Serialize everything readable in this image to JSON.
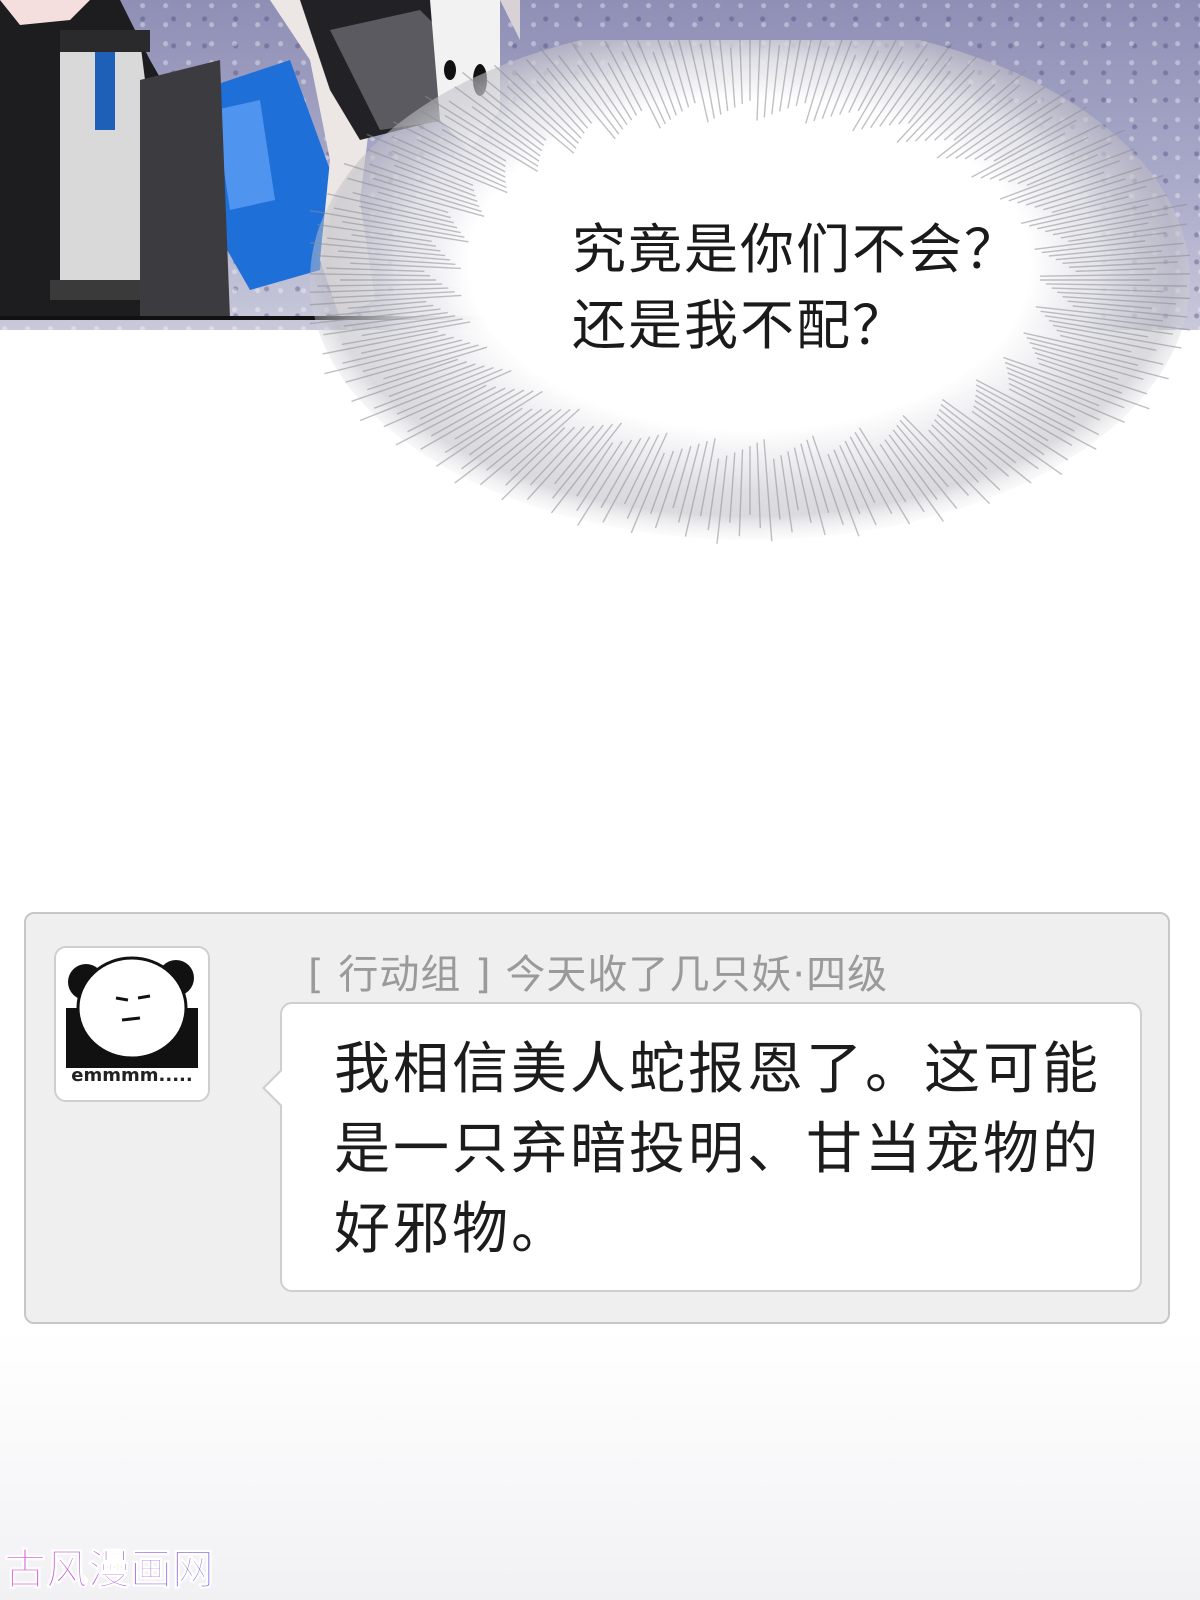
{
  "comic": {
    "speech_lines": [
      "究竟是你们不会？",
      "还是我不配？"
    ]
  },
  "comment": {
    "avatar_label": "emmmm.....",
    "username": "[ 行动组 ] 今天收了几只妖·四级",
    "body_lines": [
      "我相信美人蛇报恩了。这可能",
      "是一只弃暗投明、甘当宠物的",
      "好邪物。"
    ]
  },
  "watermark": {
    "text": "古风漫画网"
  },
  "colors": {
    "card_bg": "#efefef",
    "card_border": "#c7c7c7",
    "username": "#9a9a9a",
    "watermark_start": "#e25fd0",
    "watermark_end": "#7e63e8"
  }
}
